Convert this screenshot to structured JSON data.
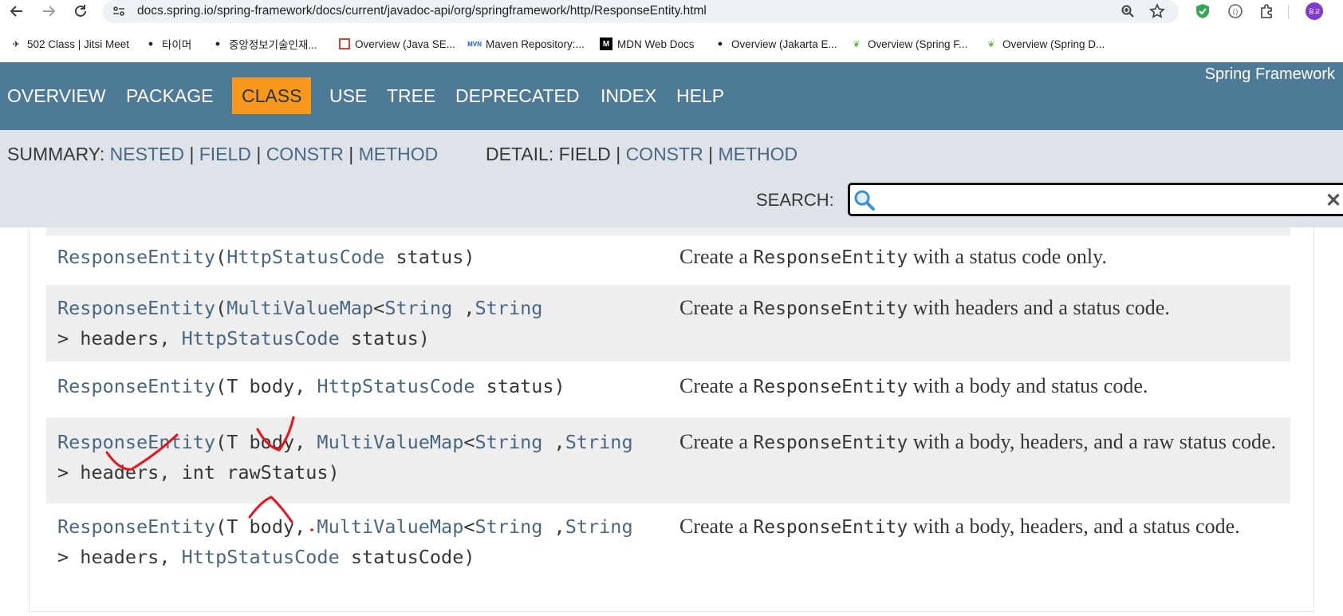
{
  "browser": {
    "url": "docs.spring.io/spring-framework/docs/current/javadoc-api/org/springframework/http/ResponseEntity.html",
    "profile_initial": "응교",
    "bookmarks": [
      "502 Class | Jitsi Meet",
      "타이머",
      "중앙정보기술인재...",
      "Overview (Java SE...",
      "Maven Repository:...",
      "MDN Web Docs",
      "Overview (Jakarta E...",
      "Overview (Spring F...",
      "Overview (Spring D..."
    ]
  },
  "javadoc": {
    "brand": "Spring Framework",
    "nav": [
      "OVERVIEW",
      "PACKAGE",
      "CLASS",
      "USE",
      "TREE",
      "DEPRECATED",
      "INDEX",
      "HELP"
    ],
    "active_nav": "CLASS",
    "summary_label": "SUMMARY:",
    "summary_links": [
      "NESTED",
      "FIELD",
      "CONSTR",
      "METHOD"
    ],
    "detail_label": "DETAIL:",
    "detail_plain": "FIELD",
    "detail_links": [
      "CONSTR",
      "METHOD"
    ],
    "sep": "|",
    "search_label": "SEARCH:",
    "search_value": ""
  },
  "constructors": [
    {
      "sig": [
        {
          "t": "ResponseEntity",
          "link": true
        },
        {
          "t": "(",
          "link": false
        },
        {
          "t": "HttpStatusCode",
          "link": true
        },
        {
          "t": " status)",
          "link": false
        }
      ],
      "desc": [
        {
          "t": "Create a ",
          "code": false
        },
        {
          "t": "ResponseEntity",
          "code": true
        },
        {
          "t": " with a status code only.",
          "code": false
        }
      ]
    },
    {
      "sig": [
        {
          "t": "ResponseEntity",
          "link": true
        },
        {
          "t": "(",
          "link": false
        },
        {
          "t": "MultiValueMap",
          "link": true
        },
        {
          "t": "<",
          "link": false
        },
        {
          "t": "String",
          "link": true
        },
        {
          "t": " ,",
          "link": false
        },
        {
          "t": "String",
          "link": true
        },
        {
          "t": "\n> headers, ",
          "link": false
        },
        {
          "t": "HttpStatusCode",
          "link": true
        },
        {
          "t": " status)",
          "link": false
        }
      ],
      "desc": [
        {
          "t": "Create a ",
          "code": false
        },
        {
          "t": "ResponseEntity",
          "code": true
        },
        {
          "t": " with headers and a status code.",
          "code": false
        }
      ]
    },
    {
      "sig": [
        {
          "t": "ResponseEntity",
          "link": true
        },
        {
          "t": "(T body, ",
          "link": false
        },
        {
          "t": "HttpStatusCode",
          "link": true
        },
        {
          "t": " status)",
          "link": false
        }
      ],
      "desc": [
        {
          "t": "Create a ",
          "code": false
        },
        {
          "t": "ResponseEntity",
          "code": true
        },
        {
          "t": " with a body and status code.",
          "code": false
        }
      ]
    },
    {
      "sig": [
        {
          "t": "ResponseEntity",
          "link": true
        },
        {
          "t": "(T body, ",
          "link": false
        },
        {
          "t": "MultiValueMap",
          "link": true
        },
        {
          "t": "<",
          "link": false
        },
        {
          "t": "String",
          "link": true
        },
        {
          "t": " ,",
          "link": false
        },
        {
          "t": "String",
          "link": true
        },
        {
          "t": "\n> headers, int rawStatus)",
          "link": false
        }
      ],
      "desc": [
        {
          "t": "Create a ",
          "code": false
        },
        {
          "t": "ResponseEntity",
          "code": true
        },
        {
          "t": " with a body, headers, and a raw status code.",
          "code": false
        }
      ]
    },
    {
      "sig": [
        {
          "t": "ResponseEntity",
          "link": true
        },
        {
          "t": "(T body, ",
          "link": false
        },
        {
          "t": "MultiValueMap",
          "link": true
        },
        {
          "t": "<",
          "link": false
        },
        {
          "t": "String",
          "link": true
        },
        {
          "t": " ,",
          "link": false
        },
        {
          "t": "String",
          "link": true
        },
        {
          "t": "\n> headers, ",
          "link": false
        },
        {
          "t": "HttpStatusCode",
          "link": true
        },
        {
          "t": " statusCode)",
          "link": false
        }
      ],
      "desc": [
        {
          "t": "Create a ",
          "code": false
        },
        {
          "t": "ResponseEntity",
          "code": true
        },
        {
          "t": " with a body, headers, and a status code.",
          "code": false
        }
      ]
    }
  ],
  "colors": {
    "nav_bg": "#4d7a97",
    "active_tab": "#f8981d",
    "subnav_bg": "#dee3e9",
    "link": "#4a6782",
    "annotation": "#e8141c"
  }
}
